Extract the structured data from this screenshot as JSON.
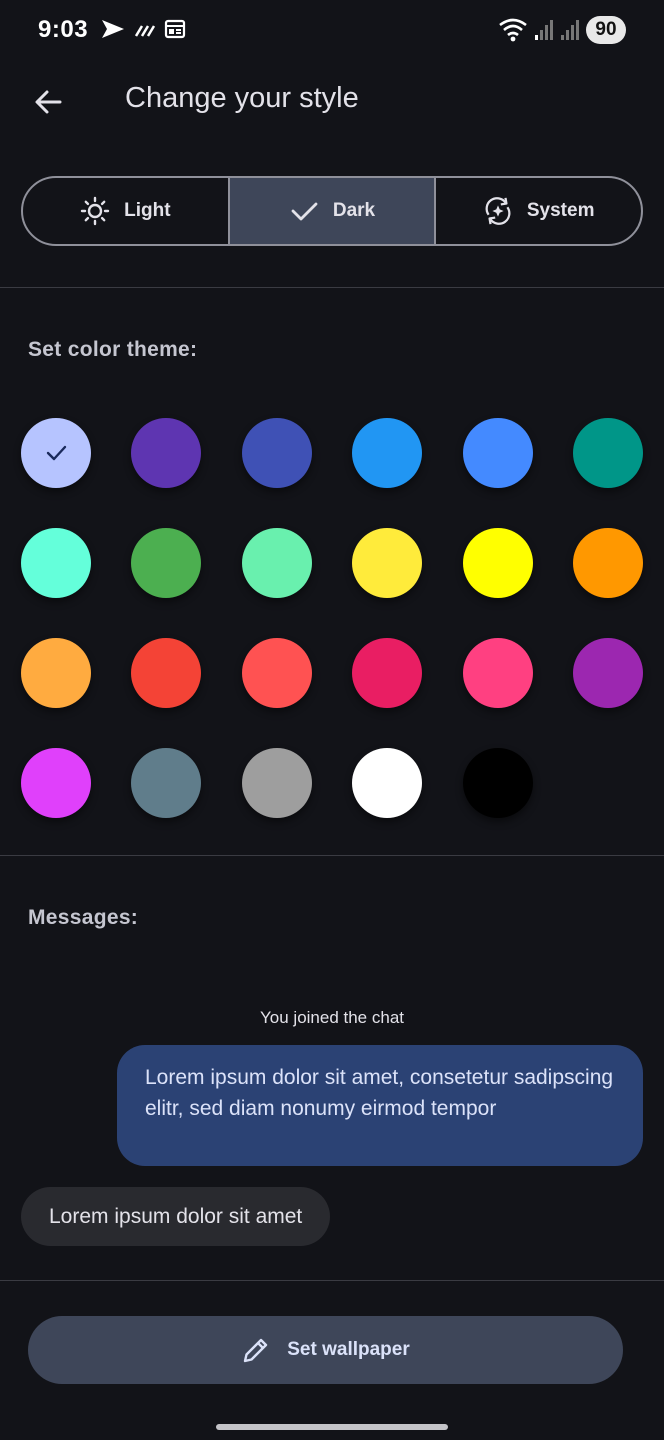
{
  "status_bar": {
    "time": "9:03",
    "battery": "90",
    "icons_left": [
      "send-icon",
      "signal-stripes-icon",
      "news-icon"
    ],
    "icons_right": [
      "wifi-icon",
      "cell-signal-icon",
      "cell-signal-icon"
    ]
  },
  "app_bar": {
    "title": "Change your style",
    "back_icon": "arrow-left-icon"
  },
  "theme_mode": {
    "options": [
      {
        "label": "Light",
        "icon": "sun-icon",
        "selected": false
      },
      {
        "label": "Dark",
        "icon": "check-icon",
        "selected": true
      },
      {
        "label": "System",
        "icon": "auto-mode-icon",
        "selected": false
      }
    ]
  },
  "color_theme": {
    "label": "Set color theme:",
    "selected_index": 0,
    "colors": [
      "#b6c4ff",
      "#5e35b1",
      "#3f51b5",
      "#2196f3",
      "#448aff",
      "#009688",
      "#64ffda",
      "#4caf50",
      "#69f0ae",
      "#ffeb3b",
      "#ffff00",
      "#ff9800",
      "#ffab40",
      "#f44336",
      "#ff5252",
      "#e91e63",
      "#ff4081",
      "#9c27b0",
      "#e040fb",
      "#607d8b",
      "#9e9e9e",
      "#ffffff",
      "#000000"
    ]
  },
  "messages": {
    "label": "Messages:",
    "system": "You joined the chat",
    "outgoing": "Lorem ipsum dolor sit amet, consetetur sadipscing elitr, sed diam nonumy eirmod tempor",
    "incoming": "Lorem ipsum dolor sit amet"
  },
  "wallpaper": {
    "label": "Set wallpaper",
    "icon": "pencil-icon"
  }
}
